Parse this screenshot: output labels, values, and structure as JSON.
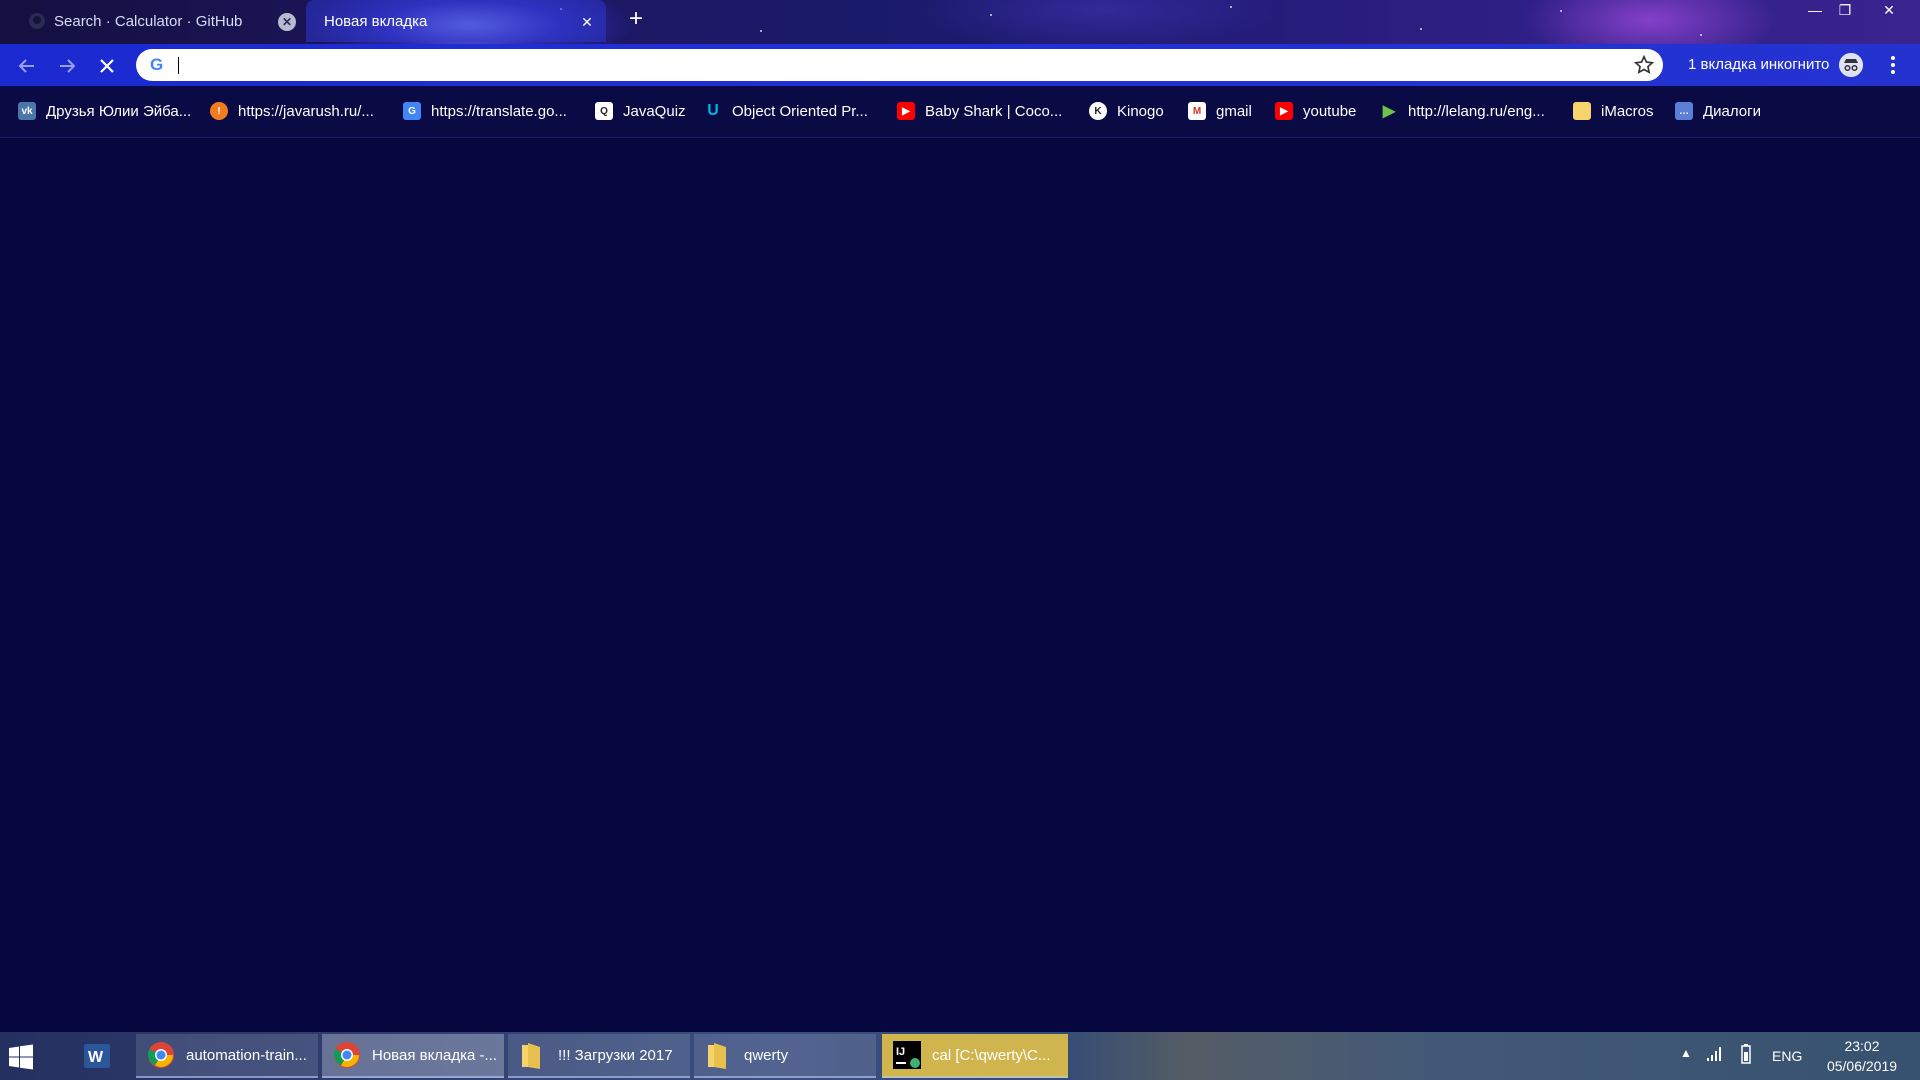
{
  "tabs": [
    {
      "title": "Search · Calculator · GitHub",
      "active": false,
      "icon": "github-icon"
    },
    {
      "title": "Новая вкладка",
      "active": true,
      "icon": ""
    }
  ],
  "toolbar": {
    "omnibox_value": "",
    "incognito_label": "1 вкладка инкогнито"
  },
  "bookmarks": [
    {
      "label": "Друзья Юлии Эйба...",
      "icon": "vk-icon",
      "color": "#4a76a8"
    },
    {
      "label": "https://javarush.ru/...",
      "icon": "javarush-icon",
      "color": "#f47c20"
    },
    {
      "label": "https://translate.go...",
      "icon": "google-translate-icon",
      "color": "#4285f4"
    },
    {
      "label": "JavaQuiz",
      "icon": "javaquiz-icon",
      "color": "#ffffff"
    },
    {
      "label": "Object Oriented Pr...",
      "icon": "udacity-icon",
      "color": "#02b3e4"
    },
    {
      "label": "Baby Shark | Coco...",
      "icon": "youtube-icon",
      "color": "#ff0000"
    },
    {
      "label": "Kinogo",
      "icon": "kinogo-icon",
      "color": "#ffffff"
    },
    {
      "label": "gmail",
      "icon": "gmail-icon",
      "color": "#d93025"
    },
    {
      "label": "youtube",
      "icon": "youtube-icon",
      "color": "#ff0000"
    },
    {
      "label": "http://lelang.ru/eng...",
      "icon": "lelang-icon",
      "color": "#6cc24a"
    },
    {
      "label": "iMacros",
      "icon": "folder-icon",
      "color": "#f6d36b"
    },
    {
      "label": "Диалоги",
      "icon": "dialogs-icon",
      "color": "#5b7fd6"
    }
  ],
  "taskbar": {
    "items": [
      {
        "label": "automation-train...",
        "icon": "chrome-icon"
      },
      {
        "label": "Новая вкладка -...",
        "icon": "chrome-icon"
      },
      {
        "label": "!!! Загрузки 2017",
        "icon": "folder-icon"
      },
      {
        "label": "qwerty",
        "icon": "folder-icon"
      },
      {
        "label": "cal [C:\\qwerty\\C...",
        "icon": "intellij-icon"
      }
    ],
    "lang": "ENG",
    "time": "23:02",
    "date": "05/06/2019"
  },
  "colors": {
    "page_background": "#07073f",
    "toolbar": "#1f2ed6",
    "bookmarks_bar": "#0a0a45"
  }
}
